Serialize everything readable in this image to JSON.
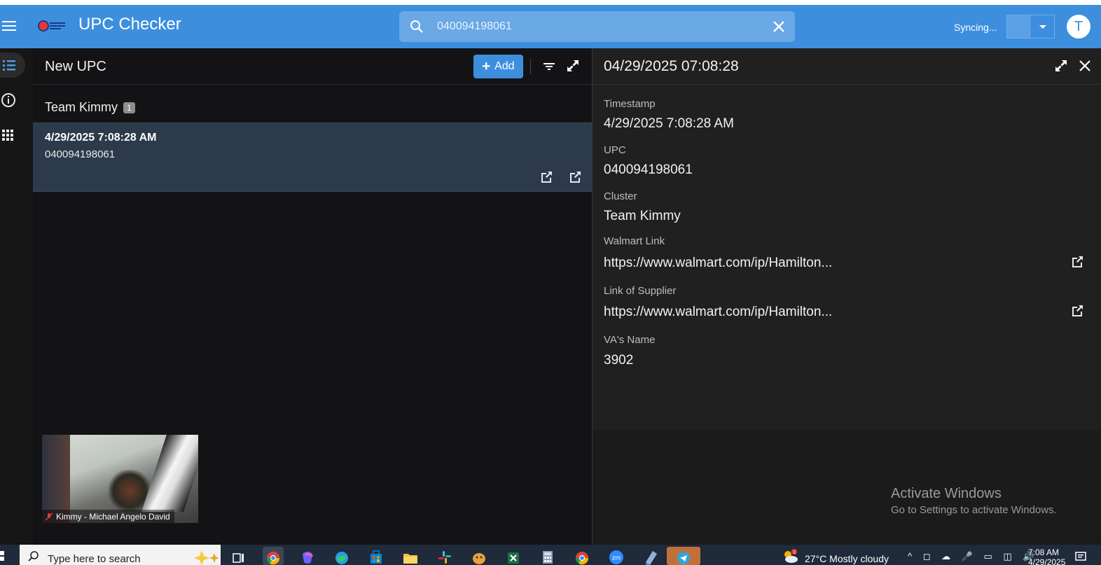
{
  "app": {
    "title": "UPC Checker",
    "sync_status": "Syncing...",
    "avatar_initial": "T"
  },
  "search": {
    "value": "040094198061",
    "placeholder": ""
  },
  "list": {
    "title": "New UPC",
    "add_label": "Add",
    "group": {
      "name": "Team Kimmy",
      "count": "1"
    },
    "items": [
      {
        "timestamp": "4/29/2025 7:08:28 AM",
        "upc": "040094198061"
      }
    ]
  },
  "detail": {
    "title": "04/29/2025 07:08:28",
    "fields": [
      {
        "label": "Timestamp",
        "value": "4/29/2025 7:08:28 AM"
      },
      {
        "label": "UPC",
        "value": "040094198061"
      },
      {
        "label": "Cluster",
        "value": "Team Kimmy"
      },
      {
        "label": "Walmart Link",
        "value": "https://www.walmart.com/ip/Hamilton..."
      },
      {
        "label": "Link of Supplier",
        "value": "https://www.walmart.com/ip/Hamilton..."
      },
      {
        "label": "VA's Name",
        "value": "3902"
      }
    ]
  },
  "video": {
    "participant": "Kimmy - Michael Angelo David"
  },
  "watermark": {
    "line1": "Activate Windows",
    "line2": "Go to Settings to activate Windows."
  },
  "taskbar": {
    "search_placeholder": "Type here to search",
    "weather": "27°C  Mostly cloudy",
    "tray": "^ ◻ ☁ 🎤 ▭ ◫ 🔊",
    "time": "7:08 AM",
    "date": "4/29/2025"
  },
  "colors": {
    "accent": "#3d8fde",
    "selected_row": "#2c3a4b",
    "panel_bg": "#131315",
    "detail_bg": "#202020"
  }
}
